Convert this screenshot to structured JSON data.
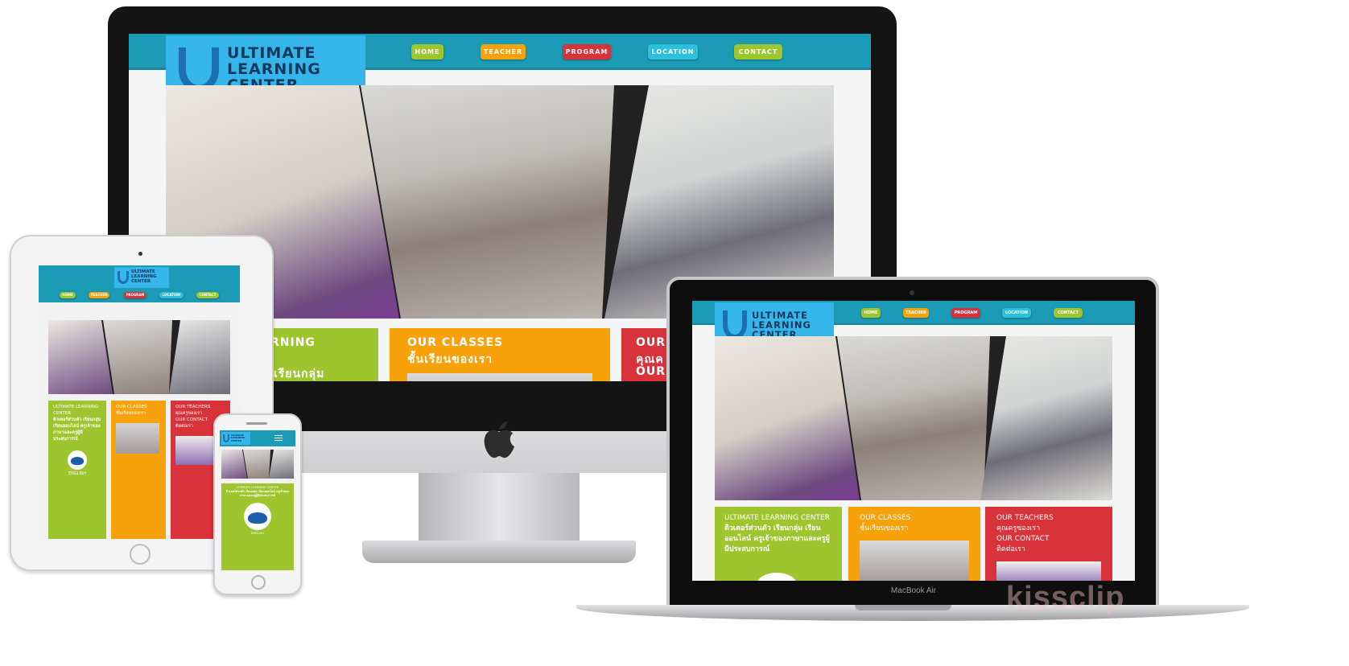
{
  "site": {
    "logo_line1": "ULTIMATE",
    "logo_line2": "LEARNING",
    "logo_line3": "CENTER",
    "nav": [
      "HOME",
      "TEACHER",
      "PROGRAM",
      "LOCATION",
      "CONTACT"
    ],
    "panel_intro_title": "ULTIMATE LEARNING CENTER",
    "panel_intro_thai": "ติวเตอร์ส่วนตัว เรียนกลุ่ม เรียนออนไลน์ ครูเจ้าของภาษาและครูผู้มีประสบการณ์",
    "panel_classes_title": "OUR CLASSES",
    "panel_classes_thai": "ชั้นเรียนของเรา",
    "panel_teachers_title": "OUR TEACHERS",
    "panel_teachers_thai": "คุณครูของเรา",
    "panel_contact_title": "OUR CONTACT",
    "panel_contact_thai": "ติดต่อเรา",
    "english_label": "ENGLISH"
  },
  "imac_partial": {
    "intro_line1": "RNING",
    "intro_line2": "เรียนกลุ่ม",
    "teachers_line1": "OUR",
    "teachers_line2": "คุณค",
    "teachers_line3": "OUR"
  },
  "device_label": "MacBook Air",
  "watermark": "kissclip",
  "colors": {
    "nav_bg": "#1b9bb5",
    "logo_bg": "#35b6ea",
    "green": "#9dc52d",
    "orange": "#f7a10b",
    "red": "#d8323a",
    "cyan": "#2bc0dc"
  }
}
